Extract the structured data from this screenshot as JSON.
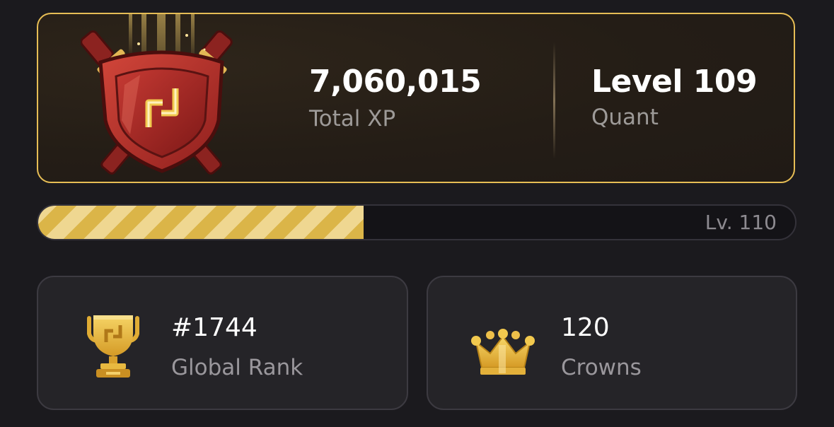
{
  "level_card": {
    "total_xp_value": "7,060,015",
    "total_xp_label": "Total XP",
    "level_value": "Level 109",
    "level_title": "Quant"
  },
  "progress": {
    "fraction": 0.43,
    "next_level_label": "Lv. 110",
    "fill_colors": [
      "#dbb548",
      "#efd791"
    ]
  },
  "stats": {
    "rank": {
      "value": "#1744",
      "label": "Global Rank",
      "icon": "trophy-icon"
    },
    "crowns": {
      "value": "120",
      "label": "Crowns",
      "icon": "crown-icon"
    }
  },
  "colors": {
    "background": "#1b1a1e",
    "gold_accent": "#e6bd55",
    "badge_red": "#b8322c"
  }
}
